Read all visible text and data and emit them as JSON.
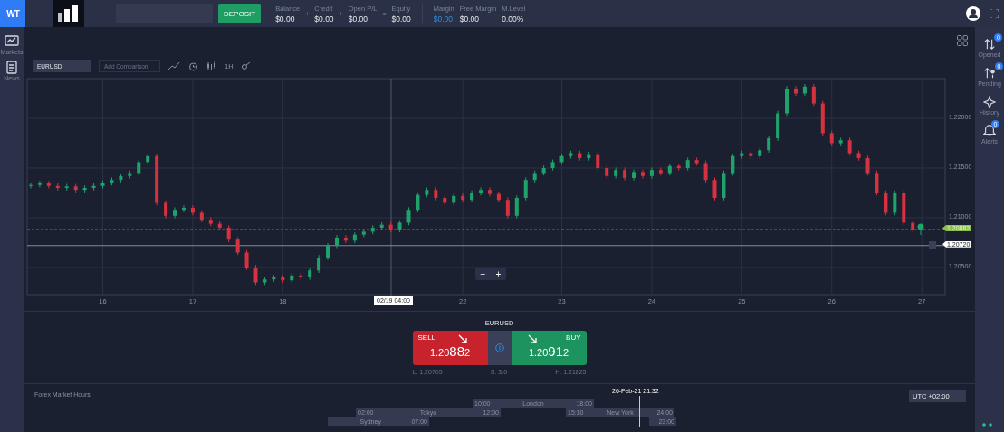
{
  "brand": "WT",
  "deposit_button": "DEPOSIT",
  "account_stats": [
    {
      "label": "Balance",
      "value": "$0.00",
      "operator": "+",
      "highlight": false
    },
    {
      "label": "Credit",
      "value": "$0.00",
      "operator": "+",
      "highlight": false
    },
    {
      "label": "Open P/L",
      "value": "$0.00",
      "operator": "=",
      "highlight": false
    },
    {
      "label": "Equity",
      "value": "$0.00",
      "highlight": false
    },
    {
      "label": "Margin",
      "value": "$0.00",
      "highlight": true
    },
    {
      "label": "Free Margin",
      "value": "$0.00",
      "highlight": false
    },
    {
      "label": "M.Level",
      "value": "0.00%",
      "highlight": false
    }
  ],
  "left_sidebar": {
    "items": [
      {
        "label": "Markets",
        "kind": "chart"
      },
      {
        "label": "News",
        "kind": "news"
      }
    ]
  },
  "right_sidebar": {
    "items": [
      {
        "label": "Opened",
        "kind": "opened",
        "badge": "0"
      },
      {
        "label": "Pending",
        "kind": "pending",
        "badge": "0"
      },
      {
        "label": "History",
        "kind": "history"
      },
      {
        "label": "Alerts",
        "kind": "alerts",
        "badge": "0"
      }
    ]
  },
  "chart": {
    "symbol": "EURUSD",
    "comparison_placeholder": "Add Comparison",
    "interval": "1H",
    "chart_data": {
      "type": "candlestick",
      "grid": true,
      "categories": [
        null,
        null,
        null,
        null,
        null,
        null,
        null,
        null,
        "16",
        null,
        null,
        null,
        null,
        null,
        null,
        null,
        null,
        null,
        "17",
        null,
        null,
        null,
        null,
        null,
        null,
        null,
        null,
        null,
        "18",
        null,
        null,
        null,
        null,
        null,
        null,
        null,
        null,
        null,
        null,
        null,
        null,
        null,
        null,
        null,
        null,
        null,
        null,
        null,
        "22",
        null,
        null,
        null,
        null,
        null,
        null,
        null,
        null,
        null,
        null,
        "23",
        null,
        null,
        null,
        null,
        null,
        null,
        null,
        null,
        null,
        "24",
        null,
        null,
        null,
        null,
        null,
        null,
        null,
        null,
        null,
        "25",
        null,
        null,
        null,
        null,
        null,
        null,
        null,
        null,
        null,
        "26",
        null,
        null,
        null,
        null,
        null,
        null,
        null,
        null,
        null,
        "27"
      ],
      "ylim": [
        1.20227,
        1.224
      ],
      "ref_lines": [
        {
          "axis": "y",
          "value": 1.20882
        },
        {
          "axis": "y",
          "value": 1.2072
        }
      ],
      "yticks": [
        {
          "value": 1.22,
          "label": "1.22000"
        },
        {
          "value": 1.215,
          "label": "1.21500"
        },
        {
          "value": 1.21,
          "label": "1.21000"
        },
        {
          "value": 1.205,
          "label": "1.20500"
        }
      ],
      "ohlc": [
        [
          1.2132,
          1.21355,
          1.21295,
          1.2133
        ],
        [
          1.2133,
          1.2137,
          1.21305,
          1.21345
        ],
        [
          1.21345,
          1.2137,
          1.21295,
          1.2132
        ],
        [
          1.2132,
          1.21345,
          1.21275,
          1.213
        ],
        [
          1.213,
          1.2134,
          1.21275,
          1.21315
        ],
        [
          1.21315,
          1.2134,
          1.21255,
          1.2128
        ],
        [
          1.2128,
          1.21325,
          1.21255,
          1.213
        ],
        [
          1.213,
          1.21345,
          1.21275,
          1.2132
        ],
        [
          1.2132,
          1.21375,
          1.21295,
          1.2135
        ],
        [
          1.2135,
          1.21405,
          1.21325,
          1.2138
        ],
        [
          1.2138,
          1.21445,
          1.21355,
          1.2142
        ],
        [
          1.2142,
          1.21475,
          1.21395,
          1.2145
        ],
        [
          1.2145,
          1.21585,
          1.21425,
          1.2156
        ],
        [
          1.2156,
          1.21645,
          1.21535,
          1.2162
        ],
        [
          1.2162,
          1.21645,
          1.21125,
          1.2115
        ],
        [
          1.2115,
          1.21175,
          1.20995,
          1.2102
        ],
        [
          1.2102,
          1.21105,
          1.20995,
          1.2108
        ],
        [
          1.2108,
          1.21125,
          1.21055,
          1.211
        ],
        [
          1.211,
          1.21125,
          1.21025,
          1.2105
        ],
        [
          1.2105,
          1.21075,
          1.20955,
          1.2098
        ],
        [
          1.2098,
          1.21005,
          1.20915,
          1.2094
        ],
        [
          1.2094,
          1.20965,
          1.20875,
          1.209
        ],
        [
          1.209,
          1.20925,
          1.20755,
          1.2078
        ],
        [
          1.2078,
          1.20805,
          1.20625,
          1.2065
        ],
        [
          1.2065,
          1.20675,
          1.20475,
          1.205
        ],
        [
          1.205,
          1.20525,
          1.20325,
          1.2035
        ],
        [
          1.2035,
          1.20405,
          1.20325,
          1.2038
        ],
        [
          1.2038,
          1.20425,
          1.20355,
          1.204
        ],
        [
          1.204,
          1.20425,
          1.20345,
          1.2037
        ],
        [
          1.2037,
          1.20445,
          1.20345,
          1.2042
        ],
        [
          1.2042,
          1.20445,
          1.20375,
          1.204
        ],
        [
          1.204,
          1.20495,
          1.20375,
          1.2047
        ],
        [
          1.2047,
          1.20625,
          1.20445,
          1.206
        ],
        [
          1.206,
          1.20745,
          1.20575,
          1.2072
        ],
        [
          1.2072,
          1.20825,
          1.20695,
          1.208
        ],
        [
          1.208,
          1.20825,
          1.20745,
          1.2077
        ],
        [
          1.2077,
          1.20855,
          1.20745,
          1.2083
        ],
        [
          1.2083,
          1.20885,
          1.20805,
          1.2086
        ],
        [
          1.2086,
          1.20925,
          1.20835,
          1.209
        ],
        [
          1.209,
          1.20955,
          1.20875,
          1.2093
        ],
        [
          1.2093,
          1.20955,
          1.20855,
          1.2088
        ],
        [
          1.2088,
          1.20975,
          1.20855,
          1.2095
        ],
        [
          1.2095,
          1.21105,
          1.20925,
          1.2108
        ],
        [
          1.2108,
          1.21255,
          1.21055,
          1.2123
        ],
        [
          1.2123,
          1.21305,
          1.21205,
          1.2128
        ],
        [
          1.2128,
          1.21305,
          1.21175,
          1.212
        ],
        [
          1.212,
          1.21225,
          1.21125,
          1.2115
        ],
        [
          1.2115,
          1.21245,
          1.21125,
          1.2122
        ],
        [
          1.2122,
          1.21245,
          1.21155,
          1.2118
        ],
        [
          1.2118,
          1.21275,
          1.21155,
          1.2125
        ],
        [
          1.2125,
          1.21305,
          1.21225,
          1.2128
        ],
        [
          1.2128,
          1.21305,
          1.21215,
          1.2124
        ],
        [
          1.2124,
          1.21265,
          1.21155,
          1.2118
        ],
        [
          1.2118,
          1.21205,
          1.20995,
          1.2102
        ],
        [
          1.2102,
          1.21225,
          1.20995,
          1.212
        ],
        [
          1.212,
          1.21405,
          1.21175,
          1.2138
        ],
        [
          1.2138,
          1.21475,
          1.21355,
          1.2145
        ],
        [
          1.2145,
          1.21525,
          1.21425,
          1.215
        ],
        [
          1.215,
          1.21585,
          1.21475,
          1.2156
        ],
        [
          1.2156,
          1.21645,
          1.21535,
          1.2162
        ],
        [
          1.2162,
          1.21675,
          1.21595,
          1.2165
        ],
        [
          1.2165,
          1.21675,
          1.21575,
          1.216
        ],
        [
          1.216,
          1.21665,
          1.21575,
          1.2164
        ],
        [
          1.2164,
          1.21665,
          1.21475,
          1.215
        ],
        [
          1.215,
          1.21525,
          1.21395,
          1.2142
        ],
        [
          1.2142,
          1.21505,
          1.21395,
          1.2148
        ],
        [
          1.2148,
          1.21505,
          1.21375,
          1.214
        ],
        [
          1.214,
          1.21485,
          1.21375,
          1.2146
        ],
        [
          1.2146,
          1.21485,
          1.21395,
          1.2142
        ],
        [
          1.2142,
          1.21505,
          1.21395,
          1.2148
        ],
        [
          1.2148,
          1.21505,
          1.21425,
          1.2145
        ],
        [
          1.2145,
          1.21545,
          1.21425,
          1.2152
        ],
        [
          1.2152,
          1.21545,
          1.21475,
          1.215
        ],
        [
          1.215,
          1.21605,
          1.21475,
          1.2158
        ],
        [
          1.2158,
          1.21605,
          1.21525,
          1.2155
        ],
        [
          1.2155,
          1.21575,
          1.21355,
          1.2138
        ],
        [
          1.2138,
          1.21405,
          1.21175,
          1.212
        ],
        [
          1.212,
          1.21475,
          1.21175,
          1.2145
        ],
        [
          1.2145,
          1.21645,
          1.21425,
          1.2162
        ],
        [
          1.2162,
          1.21675,
          1.21595,
          1.2165
        ],
        [
          1.2165,
          1.21675,
          1.21595,
          1.2162
        ],
        [
          1.2162,
          1.21705,
          1.21595,
          1.2168
        ],
        [
          1.2168,
          1.21825,
          1.21655,
          1.218
        ],
        [
          1.218,
          1.22075,
          1.21775,
          1.2205
        ],
        [
          1.2205,
          1.22325,
          1.22025,
          1.223
        ],
        [
          1.223,
          1.22325,
          1.22225,
          1.2225
        ],
        [
          1.2225,
          1.22345,
          1.22225,
          1.2232
        ],
        [
          1.2232,
          1.22345,
          1.22125,
          1.2215
        ],
        [
          1.2215,
          1.22175,
          1.21825,
          1.2185
        ],
        [
          1.2185,
          1.21875,
          1.21725,
          1.2175
        ],
        [
          1.2175,
          1.21805,
          1.21725,
          1.2178
        ],
        [
          1.2178,
          1.21805,
          1.21625,
          1.2165
        ],
        [
          1.2165,
          1.21675,
          1.21575,
          1.216
        ],
        [
          1.216,
          1.21625,
          1.21425,
          1.2145
        ],
        [
          1.2145,
          1.21475,
          1.21225,
          1.2125
        ],
        [
          1.2125,
          1.21275,
          1.21025,
          1.2105
        ],
        [
          1.2105,
          1.21275,
          1.21025,
          1.2125
        ],
        [
          1.2125,
          1.21275,
          1.20925,
          1.2095
        ],
        [
          1.2095,
          1.20975,
          1.20857,
          1.20882
        ],
        null
      ]
    },
    "crosshair_label": "02/19 04:00",
    "price_tags": [
      {
        "value": "1.20882",
        "kind": "bid"
      },
      {
        "value": "1.20720",
        "kind": "order"
      }
    ],
    "zoom_out": "−",
    "zoom_in": "+"
  },
  "trade": {
    "symbol": "EURUSD",
    "sell": {
      "label": "SELL",
      "prefix": "1.20",
      "big": "88",
      "suffix": "2"
    },
    "buy": {
      "label": "BUY",
      "prefix": "1.20",
      "big": "91",
      "suffix": "2"
    },
    "low": "L: 1.20705",
    "spread": "S: 3.0",
    "high": "H: 1.21825"
  },
  "market_hours": {
    "title": "Forex Market Hours",
    "timezone": "UTC +02:00",
    "now": "26-Feb-21 21:32",
    "segments": [
      {
        "start": "10:00",
        "name": "London",
        "end": "18:00"
      },
      {
        "start": "02:00",
        "name": "Tokyo",
        "end": "12:00"
      },
      {
        "start": "15:30",
        "name": "New York",
        "end": "24:00"
      },
      {
        "name": "Sydney",
        "end": "07:00"
      },
      {
        "end": "23:00"
      }
    ]
  }
}
